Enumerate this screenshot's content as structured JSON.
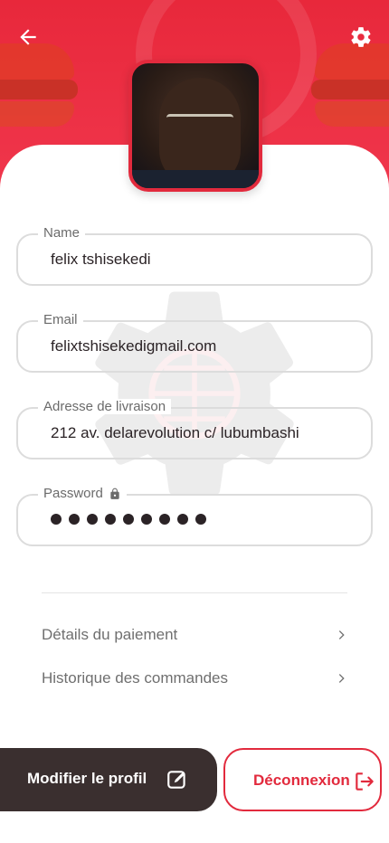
{
  "header": {
    "back_icon": "arrow-left-icon",
    "settings_icon": "gear-icon",
    "accent_color": "#e8283b"
  },
  "profile": {
    "avatar_icon": "avatar"
  },
  "fields": {
    "name": {
      "label": "Name",
      "value": "felix tshisekedi"
    },
    "email": {
      "label": "Email",
      "value": "felixtshisekedigmail.com"
    },
    "address": {
      "label": "Adresse de livraison",
      "value": "212 av. delarevolution c/ lubumbashi"
    },
    "password": {
      "label": "Password",
      "lock_icon": "lock-icon",
      "masked_length": 9
    }
  },
  "menu": {
    "payment": {
      "label": "Détails du paiement",
      "icon": "chevron-right-icon"
    },
    "orders": {
      "label": "Historique des commandes",
      "icon": "chevron-right-icon"
    }
  },
  "actions": {
    "edit_label": "Modifier le profil",
    "edit_icon": "edit-icon",
    "logout_label": "Déconnexion",
    "logout_icon": "logout-icon",
    "dark_color": "#3a2f2f",
    "danger_color": "#e22a3d"
  }
}
